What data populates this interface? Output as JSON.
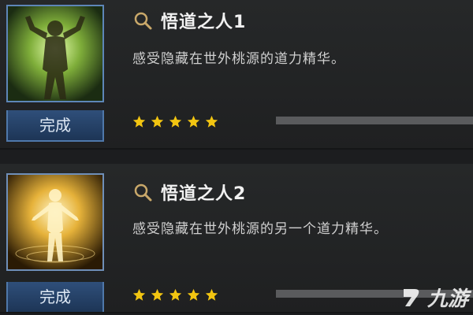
{
  "quests": [
    {
      "title": "悟道之人1",
      "description": "感受隐藏在世外桃源的道力精华。",
      "status": "完成",
      "stars": 5
    },
    {
      "title": "悟道之人2",
      "description": "感受隐藏在世外桃源的另一个道力精华。",
      "status": "完成",
      "stars": 5
    }
  ],
  "watermark": {
    "text": "九游",
    "logo": "jiuyou-logo"
  },
  "colors": {
    "background": "#1c1d1f",
    "badge": "#2f4f7a",
    "star": "#f2c511",
    "title": "#f1f1f1"
  },
  "icons": {
    "search": "search-icon",
    "star": "star-icon"
  }
}
